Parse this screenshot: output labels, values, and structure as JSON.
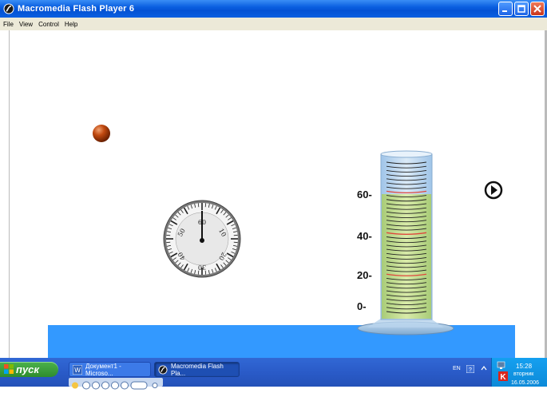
{
  "window": {
    "title": "Macromedia Flash Player 6"
  },
  "menu": {
    "items": [
      "File",
      "View",
      "Control",
      "Help"
    ]
  },
  "scene": {
    "cylinder_labels": [
      "60-",
      "40-",
      "20-",
      "0-"
    ],
    "stopwatch_numbers": [
      "60",
      "10",
      "20",
      "30",
      "40",
      "50"
    ],
    "play_icon": "play-icon",
    "ball_color": "#c0490f",
    "water_color": "#3399ff",
    "liquid_color": "#c8e08c"
  },
  "taskbar": {
    "start_label": "пуск",
    "tasks": [
      {
        "label": "Документ1 - Microso...",
        "icon": "word-icon"
      },
      {
        "label": "Macromedia Flash Pla...",
        "icon": "flash-icon"
      }
    ],
    "tray": {
      "lang": "EN",
      "time": "15:28",
      "day": "вторник",
      "date": "16.05.2006"
    }
  }
}
